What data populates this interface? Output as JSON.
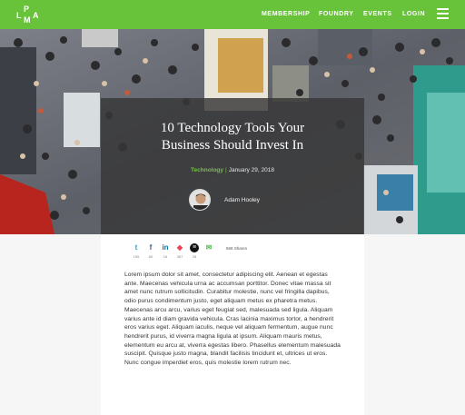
{
  "header": {
    "logo": {
      "l": "L",
      "p": "P",
      "m": "M",
      "a": "A"
    },
    "nav": [
      "MEMBERSHIP",
      "FOUNDRY",
      "EVENTS",
      "LOGIN"
    ],
    "menu_icon": "hamburger-icon",
    "bg_color": "#69c33a"
  },
  "hero": {
    "title_line1": "10 Technology Tools Your",
    "title_line2": "Business Should Invest In",
    "category": "Technology",
    "separator": "|",
    "date": "January 29, 2018",
    "author": "Adam Hooley"
  },
  "share": {
    "buttons": [
      {
        "icon": "twitter-icon",
        "glyph": "t",
        "count": "155",
        "color": "#1da1f2"
      },
      {
        "icon": "facebook-icon",
        "glyph": "f",
        "count": "60",
        "color": "#3b5998"
      },
      {
        "icon": "linkedin-icon",
        "glyph": "in",
        "count": "16",
        "color": "#0077b5"
      },
      {
        "icon": "pocket-icon",
        "glyph": "◆",
        "count": "387",
        "color": "#ef4056"
      },
      {
        "icon": "buffer-icon",
        "glyph": "≡",
        "count": "28",
        "color": "#111111"
      },
      {
        "icon": "email-icon",
        "glyph": "✉",
        "count": "",
        "color": "#5bbf5b"
      }
    ],
    "total": "668 Shares"
  },
  "article": {
    "body": "Lorem ipsum dolor sit amet, consectetur adipiscing elit. Aenean et egestas ante. Maecenas vehicula urna ac accumsan porttitor. Donec vitae massa sit amet nunc rutrum sollicitudin. Curabitur molestie, nunc vel fringilla dapibus, odio purus condimentum justo, eget aliquam metus ex pharetra metus. Maecenas arcu arcu, varius eget feugiat sed, malesuada sed ligula. Aliquam varius ante id diam gravida vehicula. Cras lacinia maximus tortor, a hendrerit eros varius eget. Aliquam iaculis, neque vel aliquam fermentum, augue nunc hendrerit purus, id viverra magna ligula at ipsum. Aliquam mauris metus, elementum eu arcu at, viverra egestas libero. Phasellus elementum malesuada suscipit. Quisque justo magna, blandit facilisis tincidunt et, ultrices ut eros. Nunc congue imperdiet eros, quis molestie lorem rutrum nec."
  }
}
